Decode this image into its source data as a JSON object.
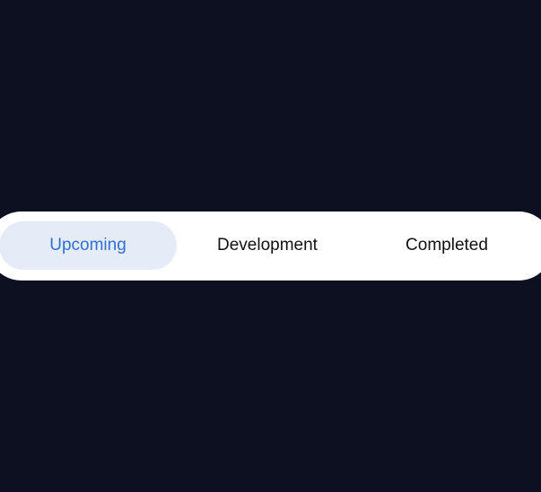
{
  "tabs": [
    {
      "label": "Upcoming",
      "active": true
    },
    {
      "label": "Development",
      "active": false
    },
    {
      "label": "Completed",
      "active": false
    }
  ],
  "colors": {
    "background": "#0c1020",
    "tab_bar": "#ffffff",
    "active_tab_bg": "#e5ecf8",
    "active_tab_text": "#2f6fd6",
    "inactive_tab_text": "#111111"
  }
}
